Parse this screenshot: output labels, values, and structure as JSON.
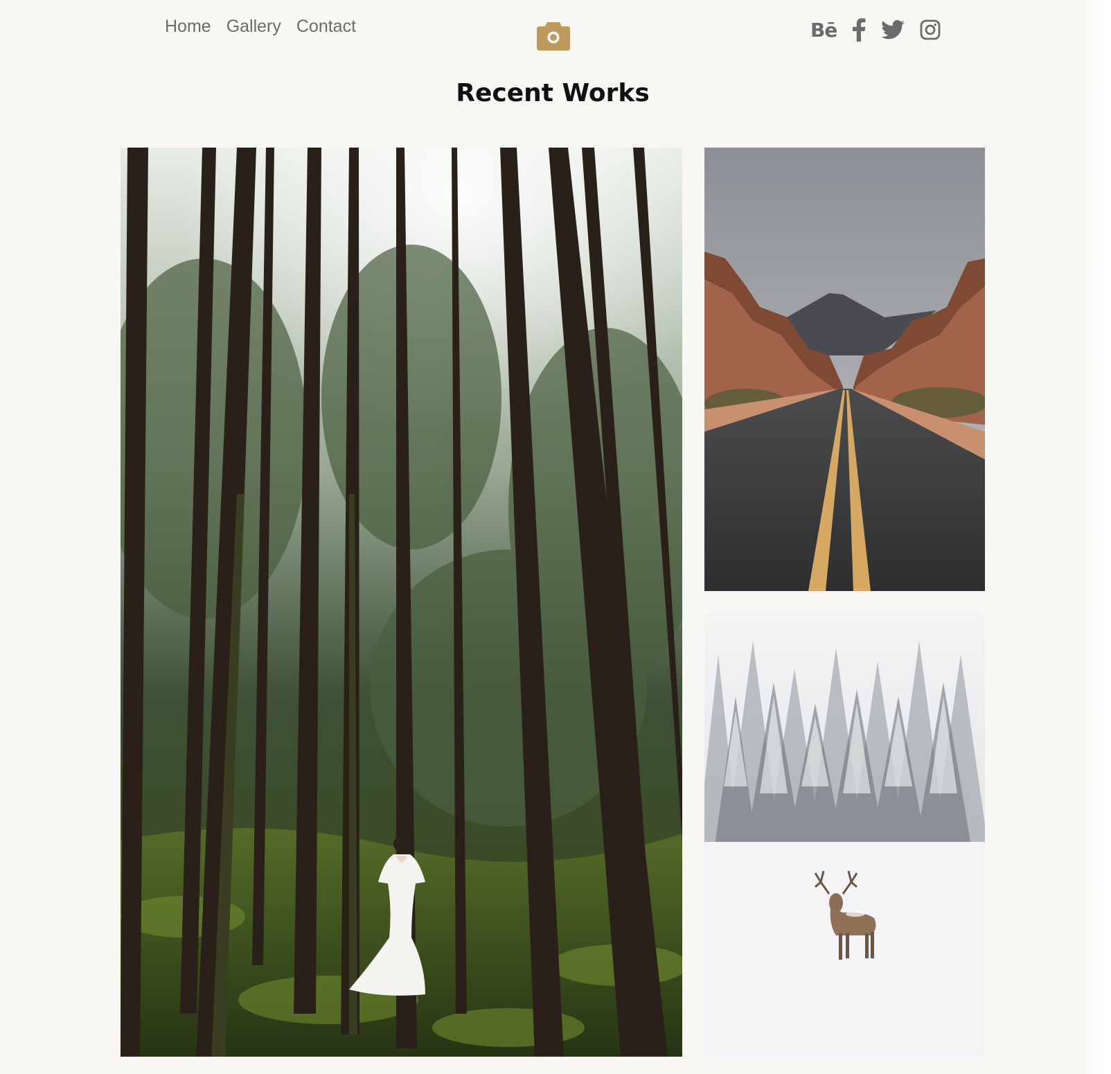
{
  "nav": {
    "items": [
      {
        "label": "Home"
      },
      {
        "label": "Gallery"
      },
      {
        "label": "Contact"
      }
    ]
  },
  "logo": {
    "icon": "camera-icon",
    "color": "#bf9a5e"
  },
  "social": {
    "behance_label": "Bē",
    "icons": [
      "behance-icon",
      "facebook-icon",
      "twitter-icon",
      "instagram-icon"
    ],
    "color": "#6b6b6b"
  },
  "section": {
    "title": "Recent Works"
  },
  "gallery": {
    "images": [
      {
        "subject": "forest-bride-image"
      },
      {
        "subject": "canyon-road-image"
      },
      {
        "subject": "snow-deer-image"
      }
    ]
  }
}
